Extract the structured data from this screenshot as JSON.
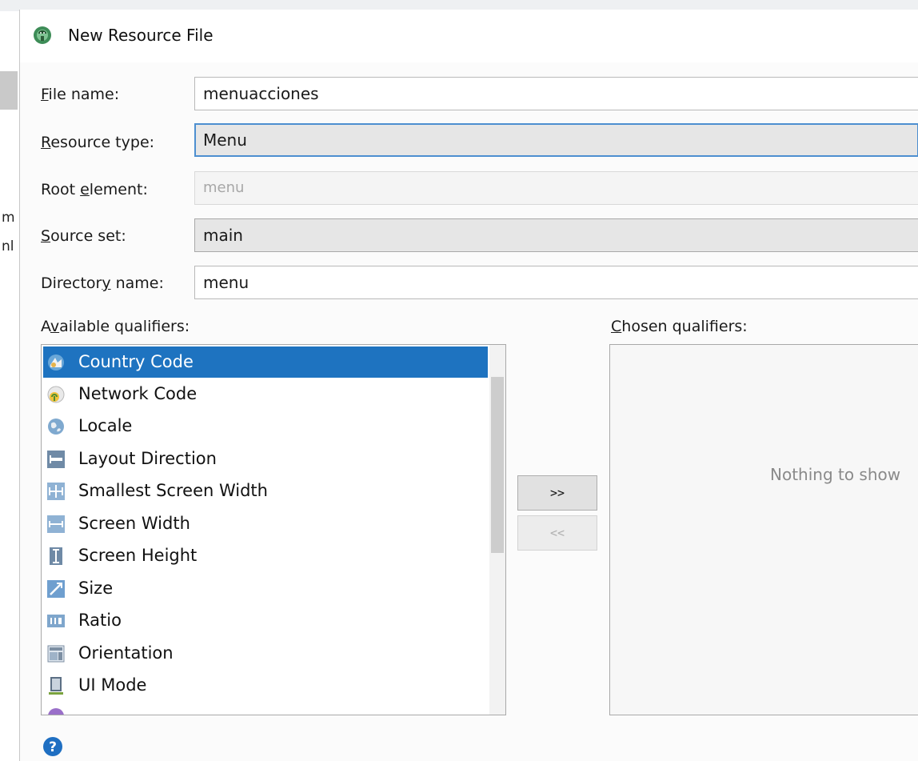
{
  "dialog": {
    "title": "New Resource File"
  },
  "background": {
    "side_chars": [
      "m",
      "nl"
    ]
  },
  "form": {
    "file_name": {
      "label_pre": "",
      "label_key": "F",
      "label_post": "ile name:",
      "value": "menuacciones"
    },
    "resource_type": {
      "label_pre": "",
      "label_key": "R",
      "label_post": "esource type:",
      "value": "Menu"
    },
    "root_element": {
      "label_pre": "Root ",
      "label_key": "e",
      "label_post": "lement:",
      "value": "menu"
    },
    "source_set": {
      "label_pre": "",
      "label_key": "S",
      "label_post": "ource set:",
      "value": "main"
    },
    "directory_name": {
      "label_pre": "Director",
      "label_key": "y",
      "label_post": " name:",
      "value": "menu"
    }
  },
  "qualifiers": {
    "available_label_pre": "A",
    "available_label_key": "v",
    "available_label_post": "ailable qualifiers:",
    "chosen_label_pre": "",
    "chosen_label_key": "C",
    "chosen_label_post": "hosen qualifiers:",
    "available": [
      {
        "label": "Country Code",
        "icon": "country-code-icon",
        "selected": true
      },
      {
        "label": "Network Code",
        "icon": "network-code-icon",
        "selected": false
      },
      {
        "label": "Locale",
        "icon": "globe-icon",
        "selected": false
      },
      {
        "label": "Layout Direction",
        "icon": "layout-direction-icon",
        "selected": false
      },
      {
        "label": "Smallest Screen Width",
        "icon": "smallest-width-icon",
        "selected": false
      },
      {
        "label": "Screen Width",
        "icon": "screen-width-icon",
        "selected": false
      },
      {
        "label": "Screen Height",
        "icon": "screen-height-icon",
        "selected": false
      },
      {
        "label": "Size",
        "icon": "size-icon",
        "selected": false
      },
      {
        "label": "Ratio",
        "icon": "ratio-icon",
        "selected": false
      },
      {
        "label": "Orientation",
        "icon": "orientation-icon",
        "selected": false
      },
      {
        "label": "UI Mode",
        "icon": "ui-mode-icon",
        "selected": false
      }
    ],
    "add_button": ">>",
    "remove_button": "<<",
    "chosen_empty_text": "Nothing to show"
  },
  "colors": {
    "selection": "#1e73c0",
    "focus_border": "#4d8fd0",
    "help": "#1f6fc2"
  }
}
